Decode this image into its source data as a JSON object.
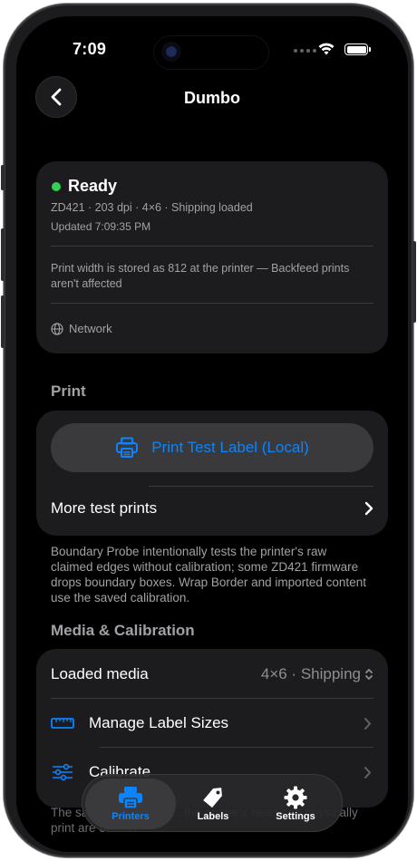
{
  "status_bar": {
    "time": "7:09"
  },
  "nav": {
    "title": "Dumbo",
    "back": "back"
  },
  "printer_status": {
    "state": "Ready",
    "summary": "ZD421 · 203 dpi · 4×6 · Shipping loaded",
    "updated": "Updated 7:09:35 PM",
    "note": "Print width is stored as 812 at the printer — Backfeed prints aren't affected",
    "connection": "Network",
    "state_color": "#30d158"
  },
  "print_section": {
    "header": "Print",
    "test_button": "Print Test Label (Local)",
    "more_label": "More test prints",
    "footnote": "Boundary Probe intentionally tests the printer's raw claimed edges without calibration; some ZD421 firmware drops boundary boxes. Wrap Border and imported content use the saved calibration."
  },
  "media_section": {
    "header": "Media & Calibration",
    "loaded_media_label": "Loaded media",
    "loaded_media_value": "4×6 · Shipping",
    "manage_label": "Manage Label Sizes",
    "calibrate_label": "Calibrate",
    "footnote": "The saved calibration ... the printer's head can physically print are offered."
  },
  "tabbar": {
    "tabs": [
      {
        "label": "Printers",
        "icon": "printer-icon",
        "active": true
      },
      {
        "label": "Labels",
        "icon": "tag-icon",
        "active": false
      },
      {
        "label": "Settings",
        "icon": "gear-icon",
        "active": false
      }
    ]
  },
  "colors": {
    "accent": "#0a84ff",
    "background": "#000000",
    "card": "#1c1c1e"
  }
}
